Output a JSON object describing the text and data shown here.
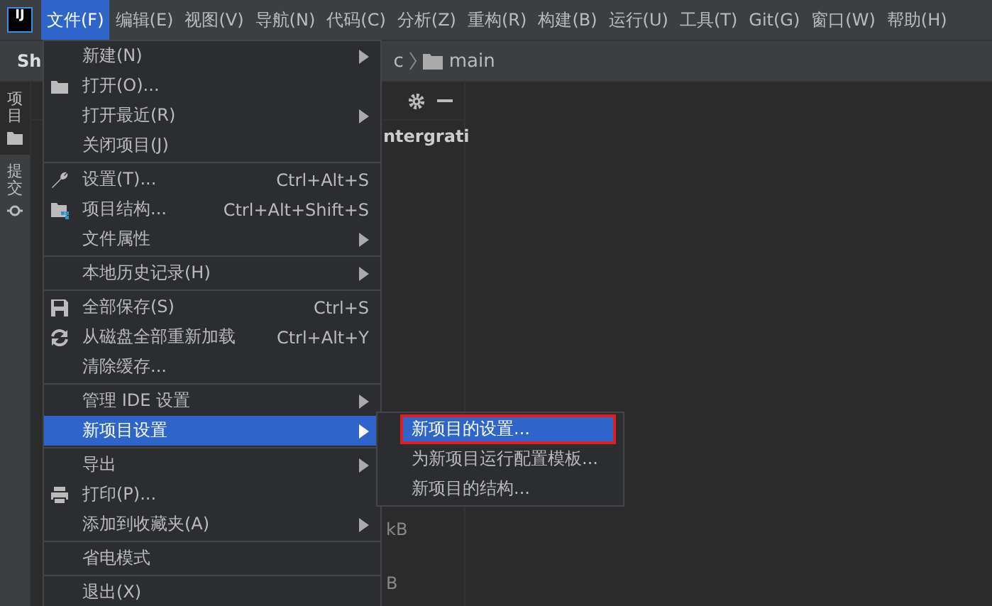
{
  "logo_text": "IJ",
  "menubar": [
    {
      "label": "文件(F)",
      "selected": true
    },
    {
      "label": "编辑(E)",
      "selected": false
    },
    {
      "label": "视图(V)",
      "selected": false
    },
    {
      "label": "导航(N)",
      "selected": false
    },
    {
      "label": "代码(C)",
      "selected": false
    },
    {
      "label": "分析(Z)",
      "selected": false
    },
    {
      "label": "重构(R)",
      "selected": false
    },
    {
      "label": "构建(B)",
      "selected": false
    },
    {
      "label": "运行(U)",
      "selected": false
    },
    {
      "label": "工具(T)",
      "selected": false
    },
    {
      "label": "Git(G)",
      "selected": false
    },
    {
      "label": "窗口(W)",
      "selected": false
    },
    {
      "label": "帮助(H)",
      "selected": false
    }
  ],
  "toolbar": {
    "project_name": "Sh",
    "breadcrumb": [
      "c",
      "main"
    ]
  },
  "side_tabs": [
    {
      "label": "项目",
      "selected": true
    },
    {
      "label": "提交",
      "selected": false
    }
  ],
  "panel": {
    "title": "ntergrati",
    "sizes": [
      "kB",
      "B"
    ]
  },
  "file_menu": [
    {
      "kind": "item",
      "label": "新建(N)",
      "submenu": true,
      "selected": false
    },
    {
      "kind": "item",
      "label": "打开(O)...",
      "submenu": false,
      "selected": false
    },
    {
      "kind": "item",
      "label": "打开最近(R)",
      "submenu": true,
      "selected": false
    },
    {
      "kind": "item",
      "label": "关闭项目(J)",
      "submenu": false,
      "selected": false
    },
    {
      "kind": "separator"
    },
    {
      "kind": "item",
      "label": "设置(T)...",
      "shortcut": "Ctrl+Alt+S",
      "submenu": false,
      "selected": false
    },
    {
      "kind": "item",
      "label": "项目结构...",
      "shortcut": "Ctrl+Alt+Shift+S",
      "submenu": false,
      "selected": false
    },
    {
      "kind": "item",
      "label": "文件属性",
      "submenu": true,
      "selected": false
    },
    {
      "kind": "separator"
    },
    {
      "kind": "item",
      "label": "本地历史记录(H)",
      "submenu": true,
      "selected": false
    },
    {
      "kind": "separator"
    },
    {
      "kind": "item",
      "label": "全部保存(S)",
      "shortcut": "Ctrl+S",
      "submenu": false,
      "selected": false
    },
    {
      "kind": "item",
      "label": "从磁盘全部重新加载",
      "shortcut": "Ctrl+Alt+Y",
      "submenu": false,
      "selected": false
    },
    {
      "kind": "item",
      "label": "清除缓存...",
      "submenu": false,
      "selected": false
    },
    {
      "kind": "separator"
    },
    {
      "kind": "item",
      "label": "管理 IDE 设置",
      "submenu": true,
      "selected": false
    },
    {
      "kind": "item",
      "label": "新项目设置",
      "submenu": true,
      "selected": true
    },
    {
      "kind": "separator"
    },
    {
      "kind": "item",
      "label": "导出",
      "submenu": true,
      "selected": false
    },
    {
      "kind": "item",
      "label": "打印(P)...",
      "submenu": false,
      "selected": false
    },
    {
      "kind": "item",
      "label": "添加到收藏夹(A)",
      "submenu": true,
      "selected": false
    },
    {
      "kind": "separator"
    },
    {
      "kind": "item",
      "label": "省电模式",
      "submenu": false,
      "selected": false
    },
    {
      "kind": "separator"
    },
    {
      "kind": "item",
      "label": "退出(X)",
      "submenu": false,
      "selected": false
    }
  ],
  "submenu": [
    {
      "label": "新项目的设置...",
      "selected": true,
      "outlined": true
    },
    {
      "label": "为新项目运行配置模板...",
      "selected": false,
      "outlined": false
    },
    {
      "label": "新项目的结构...",
      "selected": false,
      "outlined": false
    }
  ]
}
